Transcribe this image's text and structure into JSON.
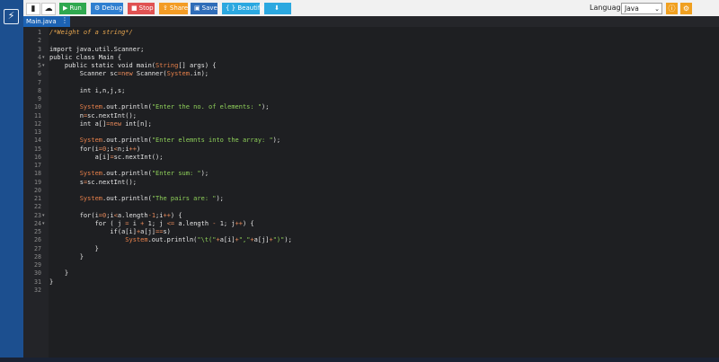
{
  "toolbar": {
    "new_icon": "new-file-icon",
    "upload_icon": "upload-icon",
    "buttons": [
      {
        "label": "Run",
        "glyph": "▶",
        "color": "#2fa84f"
      },
      {
        "label": "Debug",
        "glyph": "⚙",
        "color": "#2f7fd0"
      },
      {
        "label": "Stop",
        "glyph": "■",
        "color": "#e05252"
      },
      {
        "label": "Share",
        "glyph": "⇪",
        "color": "#f39c25"
      },
      {
        "label": "Save",
        "glyph": "▣",
        "color": "#2f6db8"
      },
      {
        "label": "{ } Beautify",
        "glyph": "",
        "color": "#2ba8e0"
      },
      {
        "label": "",
        "glyph": "⬇",
        "color": "#2ba8e0"
      }
    ],
    "language_label": "Language",
    "language_value": "Java",
    "info_icon": "info-icon",
    "settings_icon": "gear-icon"
  },
  "tab": {
    "label": "Main.java"
  },
  "editor": {
    "line_numbers": [
      "1",
      "2",
      "3",
      "4",
      "5",
      "6",
      "7",
      "8",
      "9",
      "10",
      "11",
      "12",
      "13",
      "14",
      "15",
      "16",
      "17",
      "18",
      "19",
      "20",
      "21",
      "22",
      "23",
      "24",
      "25",
      "26",
      "27",
      "28",
      "29",
      "30",
      "31",
      "32"
    ],
    "lines": [
      [
        {
          "t": "/*Weight of a string*/",
          "c": "cm"
        }
      ],
      [],
      [
        {
          "t": "import java.util.Scanner;",
          "c": "kw"
        }
      ],
      [
        {
          "t": "public class Main {",
          "c": "kw"
        }
      ],
      [
        {
          "t": "    public static void main(",
          "c": "kw"
        },
        {
          "t": "String",
          "c": "cls"
        },
        {
          "t": "[] args) {",
          "c": "kw"
        }
      ],
      [
        {
          "t": "        Scanner sc",
          "c": "kw"
        },
        {
          "t": "=new",
          "c": "op"
        },
        {
          "t": " Scanner(",
          "c": "kw"
        },
        {
          "t": "System",
          "c": "cls"
        },
        {
          "t": ".in);",
          "c": "kw"
        }
      ],
      [],
      [
        {
          "t": "        int i,n,j,s;",
          "c": "kw"
        }
      ],
      [],
      [
        {
          "t": "        ",
          "c": "kw"
        },
        {
          "t": "System",
          "c": "cls"
        },
        {
          "t": ".out.println(",
          "c": "kw"
        },
        {
          "t": "\"Enter the no. of elements: \"",
          "c": "str"
        },
        {
          "t": ");",
          "c": "kw"
        }
      ],
      [
        {
          "t": "        n",
          "c": "kw"
        },
        {
          "t": "=",
          "c": "op"
        },
        {
          "t": "sc.nextInt();",
          "c": "kw"
        }
      ],
      [
        {
          "t": "        int a[]",
          "c": "kw"
        },
        {
          "t": "=new",
          "c": "op"
        },
        {
          "t": " int[n];",
          "c": "kw"
        }
      ],
      [],
      [
        {
          "t": "        ",
          "c": "kw"
        },
        {
          "t": "System",
          "c": "cls"
        },
        {
          "t": ".out.println(",
          "c": "kw"
        },
        {
          "t": "\"Enter elemnts into the array: \"",
          "c": "str"
        },
        {
          "t": ");",
          "c": "kw"
        }
      ],
      [
        {
          "t": "        for(i",
          "c": "kw"
        },
        {
          "t": "=0",
          "c": "op"
        },
        {
          "t": ";i",
          "c": "kw"
        },
        {
          "t": "<",
          "c": "op"
        },
        {
          "t": "n;i",
          "c": "kw"
        },
        {
          "t": "++",
          "c": "op"
        },
        {
          "t": ")",
          "c": "kw"
        }
      ],
      [
        {
          "t": "            a[i]",
          "c": "kw"
        },
        {
          "t": "=",
          "c": "op"
        },
        {
          "t": "sc.nextInt();",
          "c": "kw"
        }
      ],
      [],
      [
        {
          "t": "        ",
          "c": "kw"
        },
        {
          "t": "System",
          "c": "cls"
        },
        {
          "t": ".out.println(",
          "c": "kw"
        },
        {
          "t": "\"Enter sum: \"",
          "c": "str"
        },
        {
          "t": ");",
          "c": "kw"
        }
      ],
      [
        {
          "t": "        s",
          "c": "kw"
        },
        {
          "t": "=",
          "c": "op"
        },
        {
          "t": "sc.nextInt();",
          "c": "kw"
        }
      ],
      [],
      [
        {
          "t": "        ",
          "c": "kw"
        },
        {
          "t": "System",
          "c": "cls"
        },
        {
          "t": ".out.println(",
          "c": "kw"
        },
        {
          "t": "\"The pairs are: \"",
          "c": "str"
        },
        {
          "t": ");",
          "c": "kw"
        }
      ],
      [],
      [
        {
          "t": "        for(i",
          "c": "kw"
        },
        {
          "t": "=0",
          "c": "op"
        },
        {
          "t": ";i",
          "c": "kw"
        },
        {
          "t": "<",
          "c": "op"
        },
        {
          "t": "a.length",
          "c": "kw"
        },
        {
          "t": "-1",
          "c": "op"
        },
        {
          "t": ";i",
          "c": "kw"
        },
        {
          "t": "++",
          "c": "op"
        },
        {
          "t": ") {",
          "c": "kw"
        }
      ],
      [
        {
          "t": "            for ( j ",
          "c": "kw"
        },
        {
          "t": "=",
          "c": "op"
        },
        {
          "t": " i ",
          "c": "kw"
        },
        {
          "t": "+",
          "c": "op"
        },
        {
          "t": " 1; j ",
          "c": "kw"
        },
        {
          "t": "<=",
          "c": "op"
        },
        {
          "t": " a.length ",
          "c": "kw"
        },
        {
          "t": "-",
          "c": "op"
        },
        {
          "t": " 1; j",
          "c": "kw"
        },
        {
          "t": "++",
          "c": "op"
        },
        {
          "t": ") {",
          "c": "kw"
        }
      ],
      [
        {
          "t": "                if(a[i]",
          "c": "kw"
        },
        {
          "t": "+",
          "c": "op"
        },
        {
          "t": "a[j]",
          "c": "kw"
        },
        {
          "t": "==",
          "c": "op"
        },
        {
          "t": "s)",
          "c": "kw"
        }
      ],
      [
        {
          "t": "                    ",
          "c": "kw"
        },
        {
          "t": "System",
          "c": "cls"
        },
        {
          "t": ".out.println(",
          "c": "kw"
        },
        {
          "t": "\"\\t(\"",
          "c": "str"
        },
        {
          "t": "+",
          "c": "op"
        },
        {
          "t": "a[i]",
          "c": "kw"
        },
        {
          "t": "+",
          "c": "op"
        },
        {
          "t": "\",\"",
          "c": "str"
        },
        {
          "t": "+",
          "c": "op"
        },
        {
          "t": "a[j]",
          "c": "kw"
        },
        {
          "t": "+",
          "c": "op"
        },
        {
          "t": "\")\"",
          "c": "str"
        },
        {
          "t": ");",
          "c": "kw"
        }
      ],
      [
        {
          "t": "            }",
          "c": "kw"
        }
      ],
      [
        {
          "t": "        }",
          "c": "kw"
        }
      ],
      [],
      [
        {
          "t": "    }",
          "c": "kw"
        }
      ],
      [
        {
          "t": "}",
          "c": "kw"
        }
      ],
      []
    ],
    "folds": [
      4,
      5,
      23,
      24
    ]
  }
}
